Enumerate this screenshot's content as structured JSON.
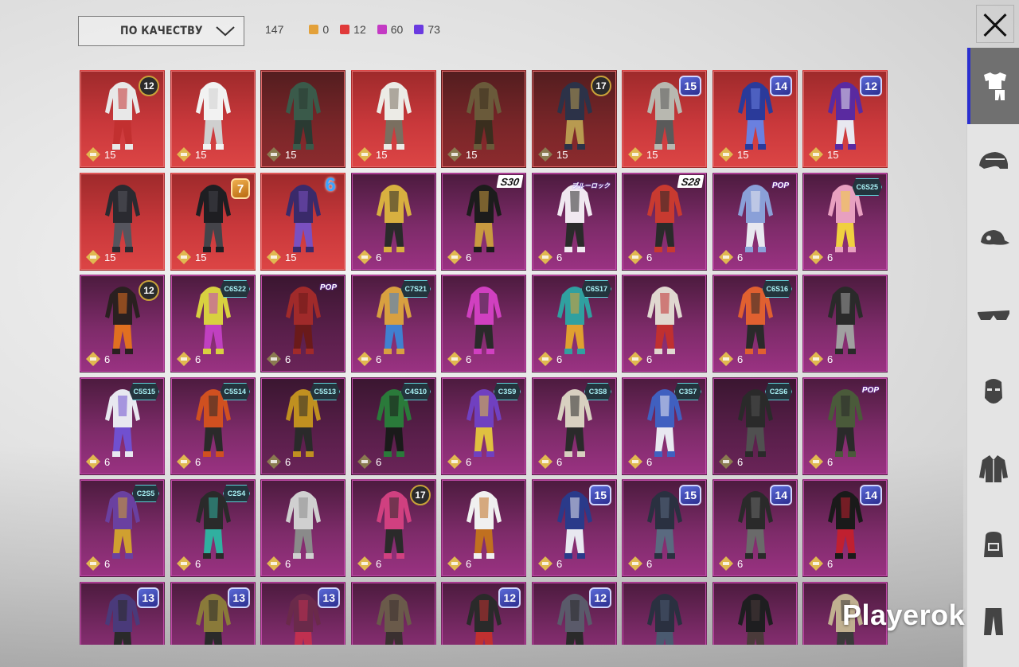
{
  "filter": {
    "sort_label": "ПО КАЧЕСТВУ",
    "total": "147",
    "quality_counts": [
      {
        "color": "#e3a13a",
        "count": "0"
      },
      {
        "color": "#e03a3a",
        "count": "12"
      },
      {
        "color": "#c43ac4",
        "count": "60"
      },
      {
        "color": "#6a3ae0",
        "count": "73"
      }
    ]
  },
  "sidebar": {
    "tabs": [
      {
        "icon": "outfit-icon",
        "active": true
      },
      {
        "icon": "helmet-icon",
        "active": false
      },
      {
        "icon": "cap-icon",
        "active": false
      },
      {
        "icon": "glasses-icon",
        "active": false
      },
      {
        "icon": "mask-icon",
        "active": false
      },
      {
        "icon": "jacket-icon",
        "active": false
      },
      {
        "icon": "backpack-icon",
        "active": false
      },
      {
        "icon": "pants-icon",
        "active": false
      }
    ]
  },
  "watermark": "Playerok",
  "items": [
    {
      "quality": "red",
      "price": "15",
      "badge": "12",
      "badge_style": "gold",
      "main": "#e8e8e8",
      "accent": "#c23030",
      "dim": false
    },
    {
      "quality": "red",
      "price": "15",
      "badge": "",
      "badge_style": "",
      "main": "#f2f2f2",
      "accent": "#cfcfcf",
      "dim": false
    },
    {
      "quality": "red",
      "price": "15",
      "badge": "",
      "badge_style": "",
      "main": "#3a5a4a",
      "accent": "#2a3a32",
      "dim": true
    },
    {
      "quality": "red",
      "price": "15",
      "badge": "",
      "badge_style": "",
      "main": "#ecebe6",
      "accent": "#7a6f60",
      "dim": false
    },
    {
      "quality": "red",
      "price": "15",
      "badge": "",
      "badge_style": "",
      "main": "#6a5a3a",
      "accent": "#3a2e1e",
      "dim": true
    },
    {
      "quality": "red",
      "price": "15",
      "badge": "17",
      "badge_style": "gold",
      "main": "#2c3248",
      "accent": "#b89a50",
      "dim": true
    },
    {
      "quality": "red",
      "price": "15",
      "badge": "15",
      "badge_style": "num",
      "main": "#b8b8b0",
      "accent": "#5a5a5a",
      "dim": false
    },
    {
      "quality": "red",
      "price": "15",
      "badge": "14",
      "badge_style": "num",
      "main": "#2a3a9a",
      "accent": "#6a80e0",
      "dim": false
    },
    {
      "quality": "red",
      "price": "15",
      "badge": "12",
      "badge_style": "num",
      "main": "#5a2aa0",
      "accent": "#e8e8f0",
      "dim": false
    },
    {
      "quality": "red",
      "price": "15",
      "badge": "",
      "badge_style": "",
      "main": "#2a2a30",
      "accent": "#55555e",
      "dim": false
    },
    {
      "quality": "red",
      "price": "15",
      "badge": "7",
      "badge_style": "orange",
      "main": "#1e1e22",
      "accent": "#44444a",
      "dim": false
    },
    {
      "quality": "red",
      "price": "15",
      "badge": "6",
      "badge_style": "blue6",
      "main": "#3a2a6a",
      "accent": "#7a50c0",
      "dim": false
    },
    {
      "quality": "pur",
      "price": "6",
      "badge": "",
      "badge_style": "",
      "main": "#d8b040",
      "accent": "#2a2a2a",
      "dim": false
    },
    {
      "quality": "pur",
      "price": "6",
      "badge": "S30",
      "badge_style": "season",
      "main": "#1c1c1c",
      "accent": "#c89a40",
      "dim": false
    },
    {
      "quality": "pur",
      "price": "6",
      "badge": "ブルーロック",
      "badge_style": "jp",
      "main": "#f0e8f0",
      "accent": "#2a2a2a",
      "dim": false
    },
    {
      "quality": "pur",
      "price": "6",
      "badge": "S28",
      "badge_style": "season",
      "main": "#c83a30",
      "accent": "#2a2a2a",
      "dim": false
    },
    {
      "quality": "pur",
      "price": "6",
      "badge": "POP",
      "badge_style": "pop",
      "main": "#8aa0d8",
      "accent": "#e8e8f0",
      "dim": false
    },
    {
      "quality": "pur",
      "price": "6",
      "badge": "C6S25",
      "badge_style": "hex",
      "main": "#e8a0c0",
      "accent": "#f0d040",
      "dim": false
    },
    {
      "quality": "pur",
      "price": "6",
      "badge": "12",
      "badge_style": "gold",
      "main": "#2a2020",
      "accent": "#e07020",
      "dim": false
    },
    {
      "quality": "pur",
      "price": "6",
      "badge": "C6S22",
      "badge_style": "hex",
      "main": "#d8d040",
      "accent": "#c040c0",
      "dim": false
    },
    {
      "quality": "pur",
      "price": "6",
      "badge": "POP",
      "badge_style": "pop",
      "main": "#a02a2a",
      "accent": "#6a1a1a",
      "dim": true
    },
    {
      "quality": "pur",
      "price": "6",
      "badge": "C7S21",
      "badge_style": "hex",
      "main": "#d8a040",
      "accent": "#4080d0",
      "dim": false
    },
    {
      "quality": "pur",
      "price": "6",
      "badge": "",
      "badge_style": "",
      "main": "#d040c0",
      "accent": "#2a2a2a",
      "dim": false
    },
    {
      "quality": "pur",
      "price": "6",
      "badge": "C6S17",
      "badge_style": "hex",
      "main": "#30a0a0",
      "accent": "#e0a030",
      "dim": false
    },
    {
      "quality": "pur",
      "price": "6",
      "badge": "",
      "badge_style": "",
      "main": "#e0d8d0",
      "accent": "#c03030",
      "dim": false
    },
    {
      "quality": "pur",
      "price": "6",
      "badge": "C6S16",
      "badge_style": "hex",
      "main": "#e06030",
      "accent": "#2a2a2a",
      "dim": false
    },
    {
      "quality": "pur",
      "price": "6",
      "badge": "",
      "badge_style": "",
      "main": "#2a2a2a",
      "accent": "#a0a0a0",
      "dim": false
    },
    {
      "quality": "pur",
      "price": "6",
      "badge": "C5S15",
      "badge_style": "hex",
      "main": "#e8e8f0",
      "accent": "#7050d0",
      "dim": false
    },
    {
      "quality": "pur",
      "price": "6",
      "badge": "C5S14",
      "badge_style": "hex",
      "main": "#d05020",
      "accent": "#2a2a2a",
      "dim": false
    },
    {
      "quality": "pur",
      "price": "6",
      "badge": "C5S13",
      "badge_style": "hex",
      "main": "#c09020",
      "accent": "#2a2a2a",
      "dim": true
    },
    {
      "quality": "pur",
      "price": "6",
      "badge": "C4S10",
      "badge_style": "hex",
      "main": "#2a7a3a",
      "accent": "#1a1a1a",
      "dim": true
    },
    {
      "quality": "pur",
      "price": "6",
      "badge": "C3S9",
      "badge_style": "hex",
      "main": "#7040c0",
      "accent": "#e0c040",
      "dim": false
    },
    {
      "quality": "pur",
      "price": "6",
      "badge": "C3S8",
      "badge_style": "hex",
      "main": "#d8d0c0",
      "accent": "#2a2a2a",
      "dim": false
    },
    {
      "quality": "pur",
      "price": "6",
      "badge": "C3S7",
      "badge_style": "hex",
      "main": "#4060c0",
      "accent": "#e8e8f0",
      "dim": false
    },
    {
      "quality": "pur",
      "price": "6",
      "badge": "C2S6",
      "badge_style": "hex",
      "main": "#2a2a2a",
      "accent": "#505050",
      "dim": true
    },
    {
      "quality": "pur",
      "price": "6",
      "badge": "POP",
      "badge_style": "pop",
      "main": "#4a5a3a",
      "accent": "#2a2a2a",
      "dim": false
    },
    {
      "quality": "pur",
      "price": "6",
      "badge": "C2S5",
      "badge_style": "hex",
      "main": "#6a40a0",
      "accent": "#d0a030",
      "dim": false
    },
    {
      "quality": "pur",
      "price": "6",
      "badge": "C2S4",
      "badge_style": "hex",
      "main": "#2a2a2a",
      "accent": "#30b0a0",
      "dim": false
    },
    {
      "quality": "pur",
      "price": "6",
      "badge": "",
      "badge_style": "",
      "main": "#d0d0d0",
      "accent": "#8a8a8a",
      "dim": false
    },
    {
      "quality": "pur",
      "price": "6",
      "badge": "17",
      "badge_style": "gold",
      "main": "#d04080",
      "accent": "#2a2a2a",
      "dim": false
    },
    {
      "quality": "pur",
      "price": "6",
      "badge": "",
      "badge_style": "",
      "main": "#f0f0f0",
      "accent": "#c07020",
      "dim": false
    },
    {
      "quality": "pur",
      "price": "6",
      "badge": "15",
      "badge_style": "num",
      "main": "#2a3a8a",
      "accent": "#e8e8f0",
      "dim": false
    },
    {
      "quality": "pur",
      "price": "6",
      "badge": "15",
      "badge_style": "num",
      "main": "#2a3040",
      "accent": "#5a6a80",
      "dim": false
    },
    {
      "quality": "pur",
      "price": "6",
      "badge": "14",
      "badge_style": "num",
      "main": "#2a2a2a",
      "accent": "#6a6a6a",
      "dim": false
    },
    {
      "quality": "pur",
      "price": "6",
      "badge": "14",
      "badge_style": "num",
      "main": "#1a1a1a",
      "accent": "#c02030",
      "dim": false
    },
    {
      "quality": "pur",
      "price": "",
      "badge": "13",
      "badge_style": "num",
      "main": "#4a3a7a",
      "accent": "#2a2a2a",
      "dim": false
    },
    {
      "quality": "pur",
      "price": "",
      "badge": "13",
      "badge_style": "num",
      "main": "#8a7a3a",
      "accent": "#2a2a2a",
      "dim": false
    },
    {
      "quality": "pur",
      "price": "",
      "badge": "13",
      "badge_style": "num",
      "main": "#6a2a4a",
      "accent": "#c03050",
      "dim": false
    },
    {
      "quality": "pur",
      "price": "",
      "badge": "",
      "badge_style": "",
      "main": "#6a5a4a",
      "accent": "#3a3030",
      "dim": false
    },
    {
      "quality": "pur",
      "price": "",
      "badge": "12",
      "badge_style": "num",
      "main": "#2a2a2a",
      "accent": "#c03030",
      "dim": false
    },
    {
      "quality": "pur",
      "price": "",
      "badge": "12",
      "badge_style": "num",
      "main": "#5a5a6a",
      "accent": "#2a2a2a",
      "dim": false
    },
    {
      "quality": "pur",
      "price": "",
      "badge": "",
      "badge_style": "",
      "main": "#2a3040",
      "accent": "#4a5a70",
      "dim": false
    },
    {
      "quality": "pur",
      "price": "",
      "badge": "",
      "badge_style": "",
      "main": "#1e1e20",
      "accent": "#4a3a3a",
      "dim": false
    },
    {
      "quality": "pur",
      "price": "",
      "badge": "",
      "badge_style": "",
      "main": "#c0b090",
      "accent": "#3a3a3a",
      "dim": false
    }
  ]
}
